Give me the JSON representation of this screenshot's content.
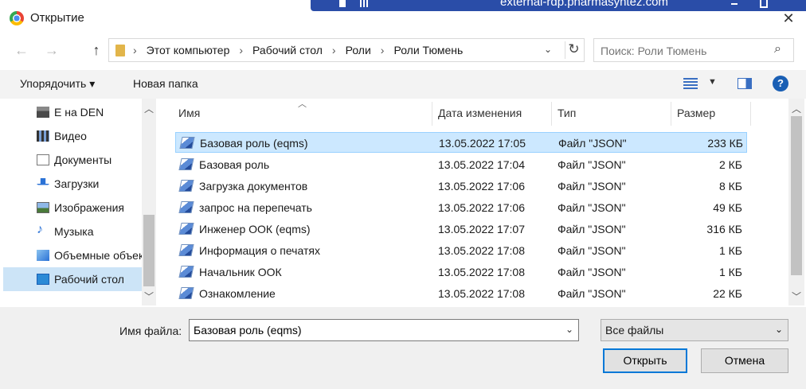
{
  "window": {
    "title": "Открытие",
    "rdp_host": "external-rdp.pharmasyntez.com",
    "close_symbol": "✕"
  },
  "nav": {
    "back_symbol": "←",
    "forward_symbol": "→",
    "up_symbol": "↑",
    "breadcrumbs": [
      "Этот компьютер",
      "Рабочий стол",
      "Роли",
      "Роли Тюмень"
    ],
    "search_placeholder": "Поиск: Роли Тюмень"
  },
  "toolbar": {
    "organize_label": "Упорядочить ▾",
    "new_folder_label": "Новая папка",
    "help_symbol": "?"
  },
  "navpane": {
    "items": [
      {
        "label": "E на DEN",
        "icon": "network-drive-icon",
        "selected": false
      },
      {
        "label": "Видео",
        "icon": "video-folder-icon",
        "selected": false
      },
      {
        "label": "Документы",
        "icon": "documents-folder-icon",
        "selected": false
      },
      {
        "label": "Загрузки",
        "icon": "downloads-folder-icon",
        "selected": false
      },
      {
        "label": "Изображения",
        "icon": "pictures-folder-icon",
        "selected": false
      },
      {
        "label": "Музыка",
        "icon": "music-folder-icon",
        "selected": false
      },
      {
        "label": "Объемные объекты",
        "icon": "3d-objects-folder-icon",
        "selected": false
      },
      {
        "label": "Рабочий стол",
        "icon": "desktop-folder-icon",
        "selected": true
      }
    ]
  },
  "columns": {
    "name": "Имя",
    "date": "Дата изменения",
    "type": "Тип",
    "size": "Размер"
  },
  "files": [
    {
      "name": "Базовая роль (eqms)",
      "date": "13.05.2022 17:05",
      "type": "Файл \"JSON\"",
      "size": "233 КБ",
      "selected": true
    },
    {
      "name": "Базовая роль",
      "date": "13.05.2022 17:04",
      "type": "Файл \"JSON\"",
      "size": "2 КБ",
      "selected": false
    },
    {
      "name": "Загрузка документов",
      "date": "13.05.2022 17:06",
      "type": "Файл \"JSON\"",
      "size": "8 КБ",
      "selected": false
    },
    {
      "name": "запрос на перепечать",
      "date": "13.05.2022 17:06",
      "type": "Файл \"JSON\"",
      "size": "49 КБ",
      "selected": false
    },
    {
      "name": "Инженер ООК (eqms)",
      "date": "13.05.2022 17:07",
      "type": "Файл \"JSON\"",
      "size": "316 КБ",
      "selected": false
    },
    {
      "name": "Информация о печатях",
      "date": "13.05.2022 17:08",
      "type": "Файл \"JSON\"",
      "size": "1 КБ",
      "selected": false
    },
    {
      "name": "Начальник ООК",
      "date": "13.05.2022 17:08",
      "type": "Файл \"JSON\"",
      "size": "1 КБ",
      "selected": false
    },
    {
      "name": "Ознакомление",
      "date": "13.05.2022 17:08",
      "type": "Файл \"JSON\"",
      "size": "22 КБ",
      "selected": false
    }
  ],
  "bottom": {
    "filename_label": "Имя файла:",
    "filename_value": "Базовая роль (eqms)",
    "filter_value": "Все файлы",
    "open_label": "Открыть",
    "cancel_label": "Отмена"
  }
}
